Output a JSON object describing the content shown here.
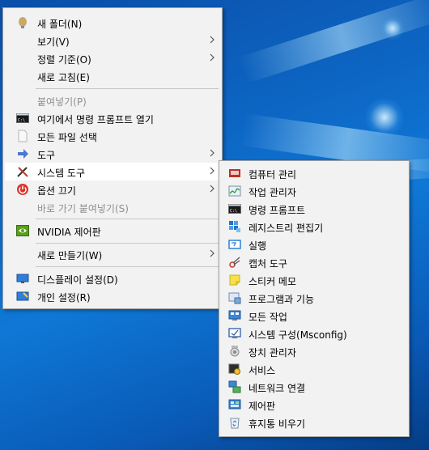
{
  "main_menu": {
    "items": [
      {
        "label": "새 폴더(N)",
        "icon": "folder-bulb-icon"
      },
      {
        "label": "보기(V)"
      },
      {
        "label": "정렬 기준(O)"
      },
      {
        "label": "새로 고침(E)"
      },
      {
        "label": "붙여넣기(P)"
      },
      {
        "label": "여기에서 명령 프롬프트 열기",
        "icon": "command-prompt-icon"
      },
      {
        "label": "모든 파일 선택",
        "icon": "file-icon"
      },
      {
        "label": "도구",
        "icon": "tools-arrow-icon"
      },
      {
        "label": "시스템 도구",
        "icon": "wrench-screwdriver-icon"
      },
      {
        "label": "옵션 끄기",
        "icon": "power-icon"
      },
      {
        "label": "바로 가기 붙여넣기(S)"
      },
      {
        "label": "NVIDIA 제어판",
        "icon": "nvidia-icon"
      },
      {
        "label": "새로 만들기(W)"
      },
      {
        "label": "디스플레이 설정(D)",
        "icon": "display-icon"
      },
      {
        "label": "개인 설정(R)",
        "icon": "personalize-icon"
      }
    ]
  },
  "sub_menu": {
    "items": [
      {
        "label": "컴퓨터 관리",
        "icon": "computer-management-icon"
      },
      {
        "label": "작업 관리자",
        "icon": "task-manager-icon"
      },
      {
        "label": "명령 프롬프트",
        "icon": "command-prompt-icon"
      },
      {
        "label": "레지스트리 편집기",
        "icon": "registry-editor-icon"
      },
      {
        "label": "실행",
        "icon": "run-icon"
      },
      {
        "label": "캡처 도구",
        "icon": "snipping-tool-icon"
      },
      {
        "label": "스티커 메모",
        "icon": "sticky-note-icon"
      },
      {
        "label": "프로그램과 기능",
        "icon": "programs-features-icon"
      },
      {
        "label": "모든 작업",
        "icon": "all-tasks-icon"
      },
      {
        "label": "시스템 구성(Msconfig)",
        "icon": "msconfig-icon"
      },
      {
        "label": "장치 관리자",
        "icon": "device-manager-icon"
      },
      {
        "label": "서비스",
        "icon": "services-icon"
      },
      {
        "label": "네트워크 연결",
        "icon": "network-connections-icon"
      },
      {
        "label": "제어판",
        "icon": "control-panel-icon"
      },
      {
        "label": "휴지통 비우기",
        "icon": "recycle-bin-icon"
      }
    ]
  }
}
